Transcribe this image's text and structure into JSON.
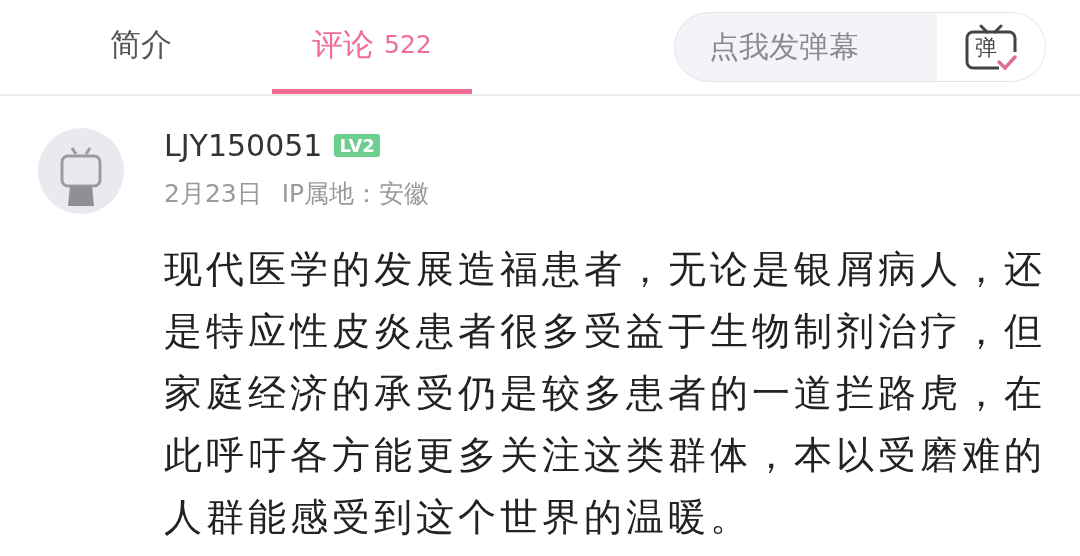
{
  "tabs": [
    {
      "label": "简介",
      "selected": false
    },
    {
      "label": "评论",
      "count": "522",
      "selected": true
    }
  ],
  "danmaku": {
    "placeholder": "点我发弹幕",
    "icon_label": "弹"
  },
  "comment": {
    "user": "LJY150051",
    "level": "LV2",
    "date": "2月23日",
    "ip": "IP属地：安徽",
    "text": "现代医学的发展造福患者，无论是银屑病人，还是特应性皮炎患者很多受益于生物制剂治疗，但家庭经济的承受仍是较多患者的一道拦路虎，在此呼吁各方能更多关注这类群体，本以受磨难的人群能感受到这个世界的温暖。"
  }
}
